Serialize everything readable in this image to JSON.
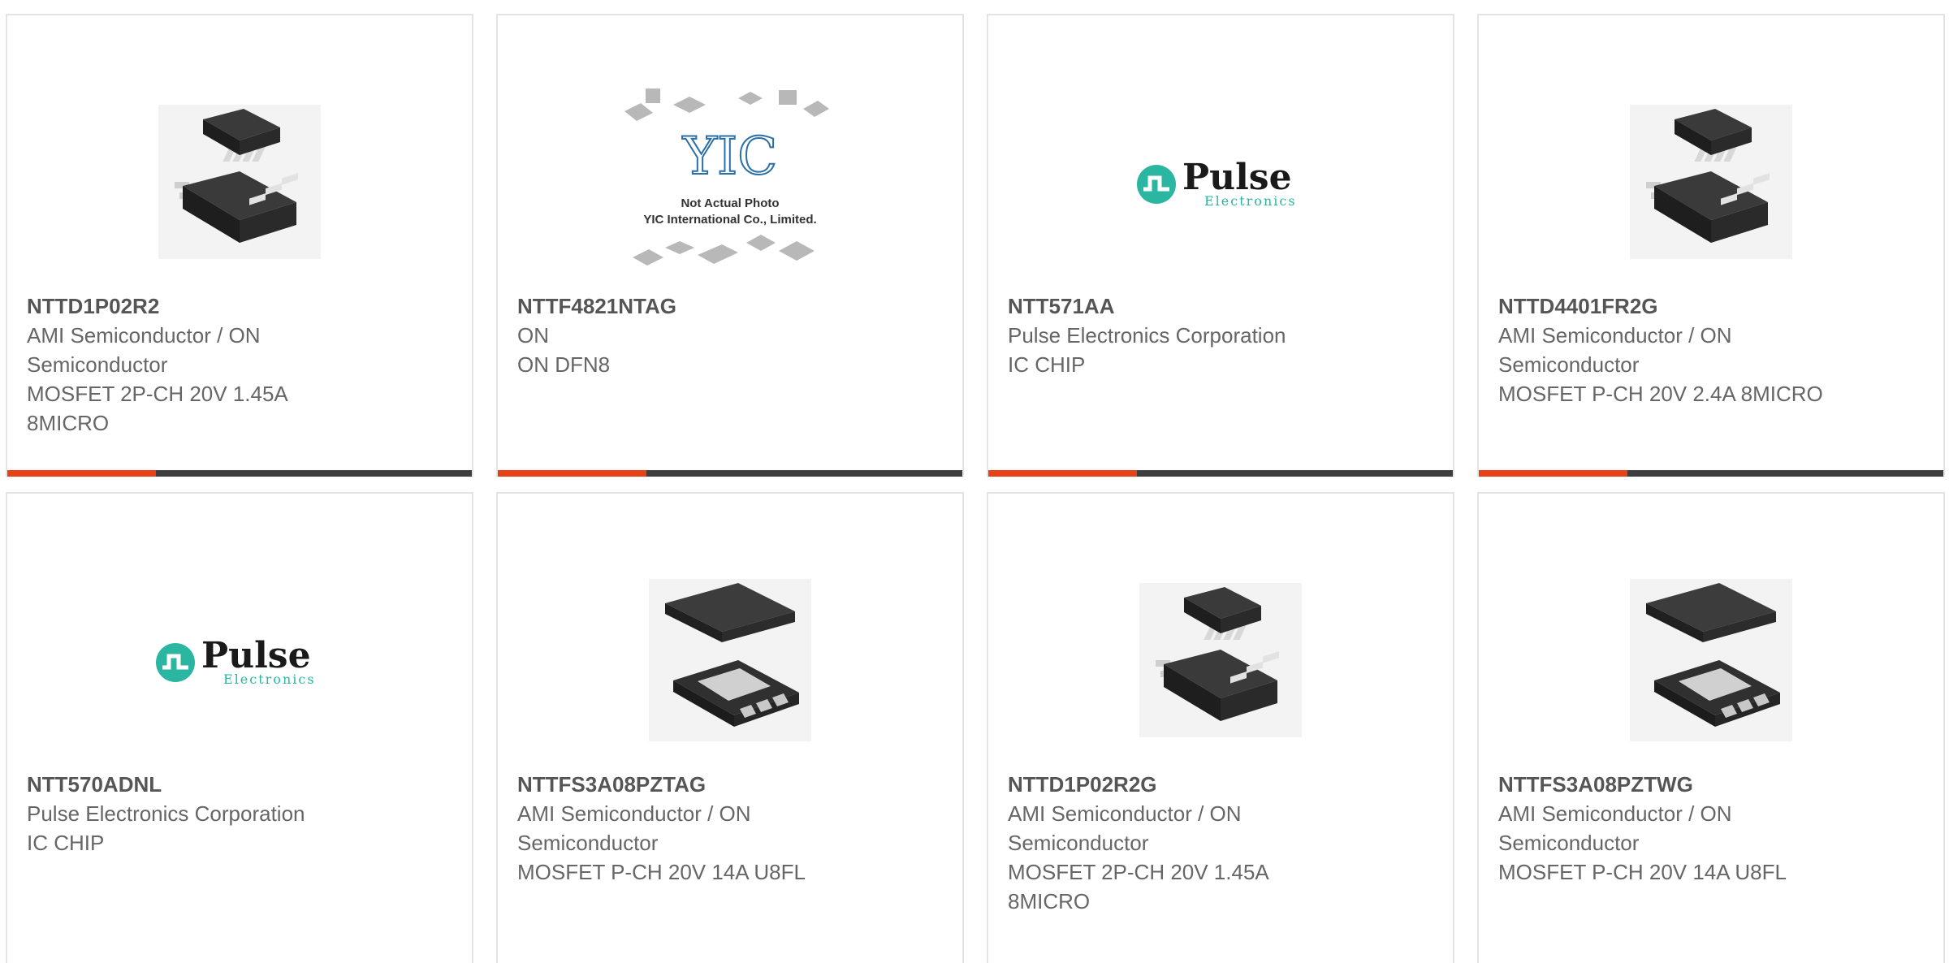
{
  "accent_color": "#e84118",
  "bar_color": "#3e3e3e",
  "cards": [
    {
      "part": "NTTD1P02R2",
      "manufacturer": "AMI Semiconductor / ON Semiconductor",
      "description": "MOSFET 2P-CH 20V 1.45A 8MICRO",
      "image": "msop8-chip-image"
    },
    {
      "part": "NTTF4821NTAG",
      "manufacturer": "ON",
      "description": "ON DFN8",
      "image": "yic-placeholder-image",
      "placeholder_line1": "Not Actual Photo",
      "placeholder_line2": "YIC International Co., Limited.",
      "placeholder_logo": "YIC"
    },
    {
      "part": "NTT571AA",
      "manufacturer": "Pulse Electronics Corporation",
      "description": "IC CHIP",
      "image": "pulse-logo",
      "logo_text": "Pulse",
      "logo_sub": "Electronics"
    },
    {
      "part": "NTTD4401FR2G",
      "manufacturer": "AMI Semiconductor / ON Semiconductor",
      "description": "MOSFET P-CH 20V 2.4A 8MICRO",
      "image": "msop8-chip-image"
    },
    {
      "part": "NTT570ADNL",
      "manufacturer": "Pulse Electronics Corporation",
      "description": "IC CHIP",
      "image": "pulse-logo",
      "logo_text": "Pulse",
      "logo_sub": "Electronics"
    },
    {
      "part": "NTTFS3A08PZTAG",
      "manufacturer": "AMI Semiconductor / ON Semiconductor",
      "description": "MOSFET P-CH 20V 14A U8FL",
      "image": "u8fl-chip-image"
    },
    {
      "part": "NTTD1P02R2G",
      "manufacturer": "AMI Semiconductor / ON Semiconductor",
      "description": "MOSFET 2P-CH 20V 1.45A 8MICRO",
      "image": "msop8-chip-image"
    },
    {
      "part": "NTTFS3A08PZTWG",
      "manufacturer": "AMI Semiconductor / ON Semiconductor",
      "description": "MOSFET P-CH 20V 14A U8FL",
      "image": "u8fl-chip-image"
    }
  ]
}
